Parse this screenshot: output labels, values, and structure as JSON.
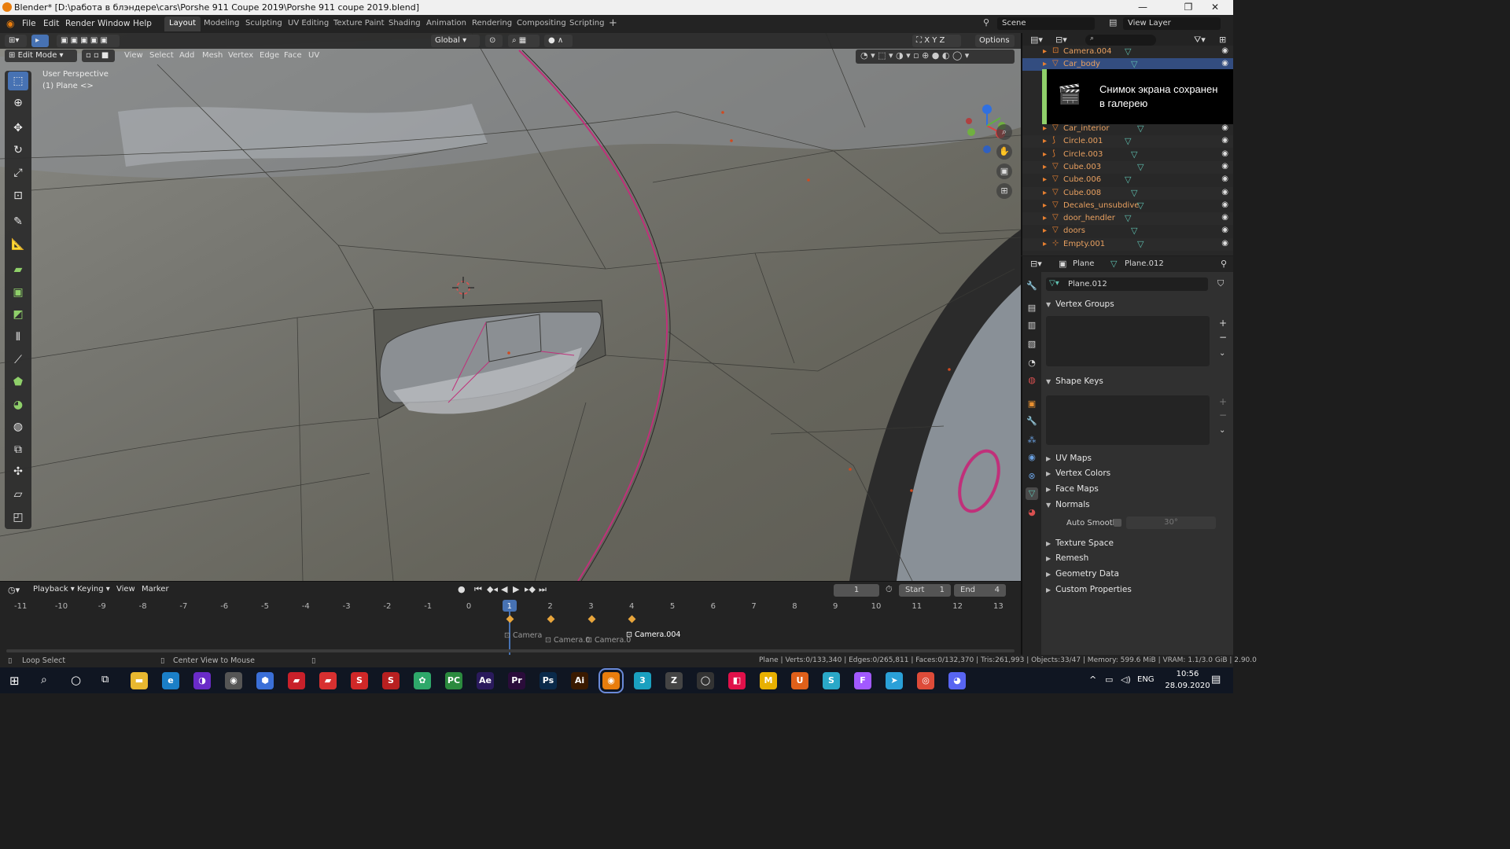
{
  "window": {
    "title": "Blender* [D:\\работа в блэндере\\cars\\Porshe 911 Coupe 2019\\Porshe 911 coupe 2019.blend]",
    "minimize": "—",
    "maximize": "❐",
    "close": "✕"
  },
  "menubar": {
    "items": [
      "File",
      "Edit",
      "Render",
      "Window",
      "Help"
    ],
    "workspaces": [
      "Layout",
      "Modeling",
      "Sculpting",
      "UV Editing",
      "Texture Paint",
      "Shading",
      "Animation",
      "Rendering",
      "Compositing",
      "Scripting"
    ],
    "active_workspace": "Layout",
    "add_workspace": "+",
    "scene_label": "Scene",
    "view_layer_label": "View Layer"
  },
  "viewport": {
    "mode": "Edit Mode",
    "menus": [
      "View",
      "Select",
      "Add",
      "Mesh",
      "Vertex",
      "Edge",
      "Face",
      "UV"
    ],
    "transform_orientation": "Global",
    "options_label": "Options",
    "axes": [
      "X",
      "Y",
      "Z"
    ],
    "overlay_line1": "User Perspective",
    "overlay_line2": "(1) Plane <>",
    "gizmo": {
      "x": "X",
      "y": "Y",
      "z": "Z"
    },
    "colors": {
      "accent": "#4772b3",
      "edge_selected": "#c0307a",
      "surface": "#6c6b62"
    }
  },
  "toolbar": {
    "tools": [
      "select-box-icon",
      "cursor-icon",
      "move-icon",
      "rotate-icon",
      "scale-icon",
      "transform-icon",
      "annotate-icon",
      "measure-icon",
      "extrude-icon",
      "inset-icon",
      "bevel-icon",
      "loop-cut-icon",
      "knife-icon",
      "poly-build-icon",
      "spin-icon",
      "smooth-icon",
      "edge-slide-icon",
      "shrink-fatten-icon",
      "shear-icon",
      "rip-icon"
    ]
  },
  "timeline": {
    "menus": [
      "Playback",
      "Keying",
      "View",
      "Marker"
    ],
    "current_frame": "1",
    "start_label": "Start",
    "start_value": "1",
    "end_label": "End",
    "end_value": "4",
    "ticks": [
      "-11",
      "-10",
      "-9",
      "-8",
      "-7",
      "-6",
      "-5",
      "-4",
      "-3",
      "-2",
      "-1",
      "0",
      "1",
      "2",
      "3",
      "4",
      "5",
      "6",
      "7",
      "8",
      "9",
      "10",
      "11",
      "12",
      "13"
    ],
    "markers": [
      "Camera",
      "Camera.0",
      "Camera.0",
      "Camera.004"
    ]
  },
  "statusbar": {
    "left_action": "Loop Select",
    "mid_action": "Center View to Mouse",
    "stats": "Plane | Verts:0/133,340 | Edges:0/265,811 | Faces:0/132,370 | Tris:261,993 | Objects:33/47 | Memory: 599.6 MiB | VRAM: 1.1/3.0 GiB | 2.90.0"
  },
  "outliner": {
    "search_placeholder": "",
    "rows": [
      {
        "name": "Camera.004",
        "type": "camera"
      },
      {
        "name": "Car_body",
        "type": "mesh",
        "selected": true
      },
      {
        "name": "Car_interior",
        "type": "mesh"
      },
      {
        "name": "Circle.001",
        "type": "curve"
      },
      {
        "name": "Circle.003",
        "type": "curve"
      },
      {
        "name": "Cube.003",
        "type": "mesh"
      },
      {
        "name": "Cube.006",
        "type": "mesh"
      },
      {
        "name": "Cube.008",
        "type": "mesh"
      },
      {
        "name": "Decales_unsubdive",
        "type": "mesh"
      },
      {
        "name": "door_hendler",
        "type": "mesh"
      },
      {
        "name": "doors",
        "type": "mesh"
      },
      {
        "name": "Empty.001",
        "type": "empty"
      }
    ]
  },
  "toast": {
    "line1": "Снимок экрана сохранен",
    "line2": "в галерею"
  },
  "properties": {
    "object_name": "Plane",
    "mesh_name": "Plane.012",
    "data_block": "Plane.012",
    "panels": [
      {
        "label": "Vertex Groups",
        "open": true
      },
      {
        "label": "Shape Keys",
        "open": true
      },
      {
        "label": "UV Maps",
        "open": false
      },
      {
        "label": "Vertex Colors",
        "open": false
      },
      {
        "label": "Face Maps",
        "open": false
      },
      {
        "label": "Normals",
        "open": true
      },
      {
        "label": "Texture Space",
        "open": false
      },
      {
        "label": "Remesh",
        "open": false
      },
      {
        "label": "Geometry Data",
        "open": false
      },
      {
        "label": "Custom Properties",
        "open": false
      }
    ],
    "auto_smooth_label": "Auto Smooth",
    "auto_smooth_angle": "30°"
  },
  "taskbar": {
    "lang": "ENG",
    "time": "10:56",
    "date": "28.09.2020",
    "apps": [
      {
        "name": "explorer",
        "label": "▬",
        "color": "#e8b830"
      },
      {
        "name": "edge",
        "label": "e",
        "color": "#1b7fc7"
      },
      {
        "name": "app-purple",
        "label": "◑",
        "color": "#6a2bc8"
      },
      {
        "name": "app-gray",
        "label": "◉",
        "color": "#555"
      },
      {
        "name": "app-hex",
        "label": "⬢",
        "color": "#3a6fd8"
      },
      {
        "name": "app-red1",
        "label": "▰",
        "color": "#c8202a"
      },
      {
        "name": "app-red2",
        "label": "▰",
        "color": "#d83030"
      },
      {
        "name": "app-red3",
        "label": "S",
        "color": "#d02828"
      },
      {
        "name": "app-red4",
        "label": "S",
        "color": "#b82020"
      },
      {
        "name": "app-green",
        "label": "✿",
        "color": "#2ea86a"
      },
      {
        "name": "pycharm",
        "label": "PC",
        "color": "#2b8a3e"
      },
      {
        "name": "after-effects",
        "label": "Ae",
        "color": "#2a1a5c"
      },
      {
        "name": "premiere",
        "label": "Pr",
        "color": "#2a0c3a"
      },
      {
        "name": "photoshop",
        "label": "Ps",
        "color": "#0a2a4a"
      },
      {
        "name": "illustrator",
        "label": "Ai",
        "color": "#3a1a00"
      },
      {
        "name": "blender",
        "label": "◉",
        "color": "#e87d0d"
      },
      {
        "name": "app-3",
        "label": "3",
        "color": "#1aa0c0"
      },
      {
        "name": "app-zbrush",
        "label": "Z",
        "color": "#444"
      },
      {
        "name": "app-ring",
        "label": "◯",
        "color": "#333"
      },
      {
        "name": "app-pink",
        "label": "◧",
        "color": "#e0104a"
      },
      {
        "name": "app-m",
        "label": "M",
        "color": "#e8b000"
      },
      {
        "name": "app-orange",
        "label": "U",
        "color": "#e0601a"
      },
      {
        "name": "app-s",
        "label": "S",
        "color": "#2aa8c8"
      },
      {
        "name": "figma",
        "label": "F",
        "color": "#a259ff"
      },
      {
        "name": "telegram",
        "label": "➤",
        "color": "#2aa0d8"
      },
      {
        "name": "chrome",
        "label": "◎",
        "color": "#dd4b39"
      },
      {
        "name": "discord",
        "label": "◕",
        "color": "#5865f2"
      }
    ]
  }
}
